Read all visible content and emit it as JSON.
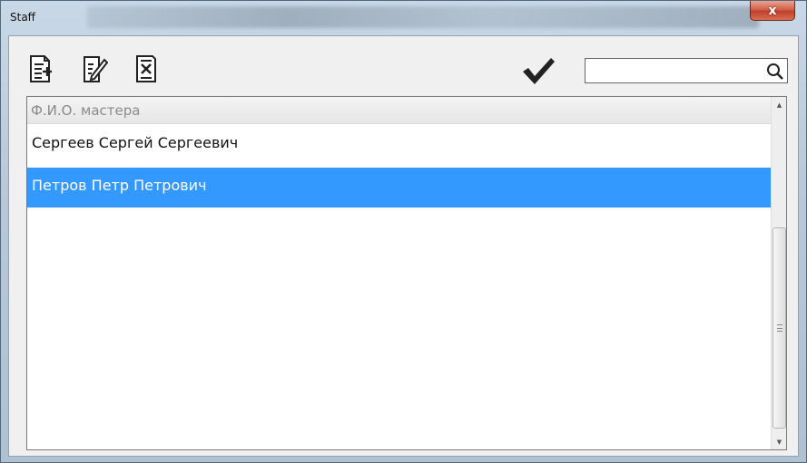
{
  "window": {
    "title": "Staff",
    "close_glyph": "x"
  },
  "toolbar": {
    "buttons": [
      {
        "name": "add-record-icon"
      },
      {
        "name": "edit-record-icon"
      },
      {
        "name": "delete-record-icon"
      }
    ],
    "confirm_icon": "checkmark-icon",
    "search": {
      "value": "",
      "placeholder": ""
    },
    "search_icon": "search-icon"
  },
  "list": {
    "header": "Ф.И.О. мастера",
    "rows": [
      {
        "label": "Сергеев Сергей Сергеевич",
        "selected": false
      },
      {
        "label": "Петров Петр Петрович",
        "selected": true
      }
    ]
  },
  "colors": {
    "selection": "#3399ff",
    "close_button": "#c0402a"
  }
}
